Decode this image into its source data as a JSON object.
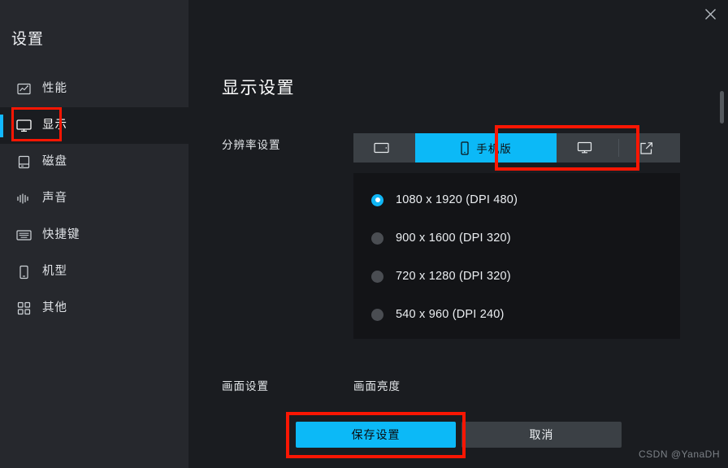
{
  "app": {
    "title": "设置",
    "close_icon": "close-icon",
    "watermark": "CSDN @YanaDH"
  },
  "sidebar": {
    "items": [
      {
        "label": "性能",
        "icon": "chart-performance-icon",
        "active": false
      },
      {
        "label": "显示",
        "icon": "monitor-display-icon",
        "active": true
      },
      {
        "label": "磁盘",
        "icon": "hard-disk-icon",
        "active": false
      },
      {
        "label": "声音",
        "icon": "sound-wave-icon",
        "active": false
      },
      {
        "label": "快捷键",
        "icon": "keyboard-icon",
        "active": false
      },
      {
        "label": "机型",
        "icon": "phone-device-icon",
        "active": false
      },
      {
        "label": "其他",
        "icon": "grid-apps-icon",
        "active": false
      }
    ]
  },
  "main": {
    "page_title": "显示设置",
    "resolution": {
      "label": "分辨率设置",
      "tabs": [
        {
          "label": "",
          "icon": "tablet-landscape-icon",
          "selected": false
        },
        {
          "label": "手机版",
          "icon": "phone-portrait-icon",
          "selected": true
        },
        {
          "label": "",
          "icon": "monitor-icon",
          "selected": false
        },
        {
          "label": "",
          "icon": "edit-square-icon",
          "selected": false
        }
      ],
      "options": [
        {
          "label": "1080 x 1920 (DPI 480)",
          "selected": true
        },
        {
          "label": "900 x 1600 (DPI 320)",
          "selected": false
        },
        {
          "label": "720 x 1280 (DPI 320)",
          "selected": false
        },
        {
          "label": "540 x 960 (DPI 240)",
          "selected": false
        }
      ]
    },
    "picture": {
      "label": "画面设置",
      "brightness_label": "画面亮度"
    },
    "actions": {
      "save_label": "保存设置",
      "cancel_label": "取消"
    }
  },
  "colors": {
    "accent": "#0cb9f7",
    "highlight_box": "#fa1603",
    "sidebar_bg": "#26282d",
    "main_bg": "#1a1c20",
    "panel_bg": "#131417",
    "tabbar_bg": "#3b4045"
  }
}
